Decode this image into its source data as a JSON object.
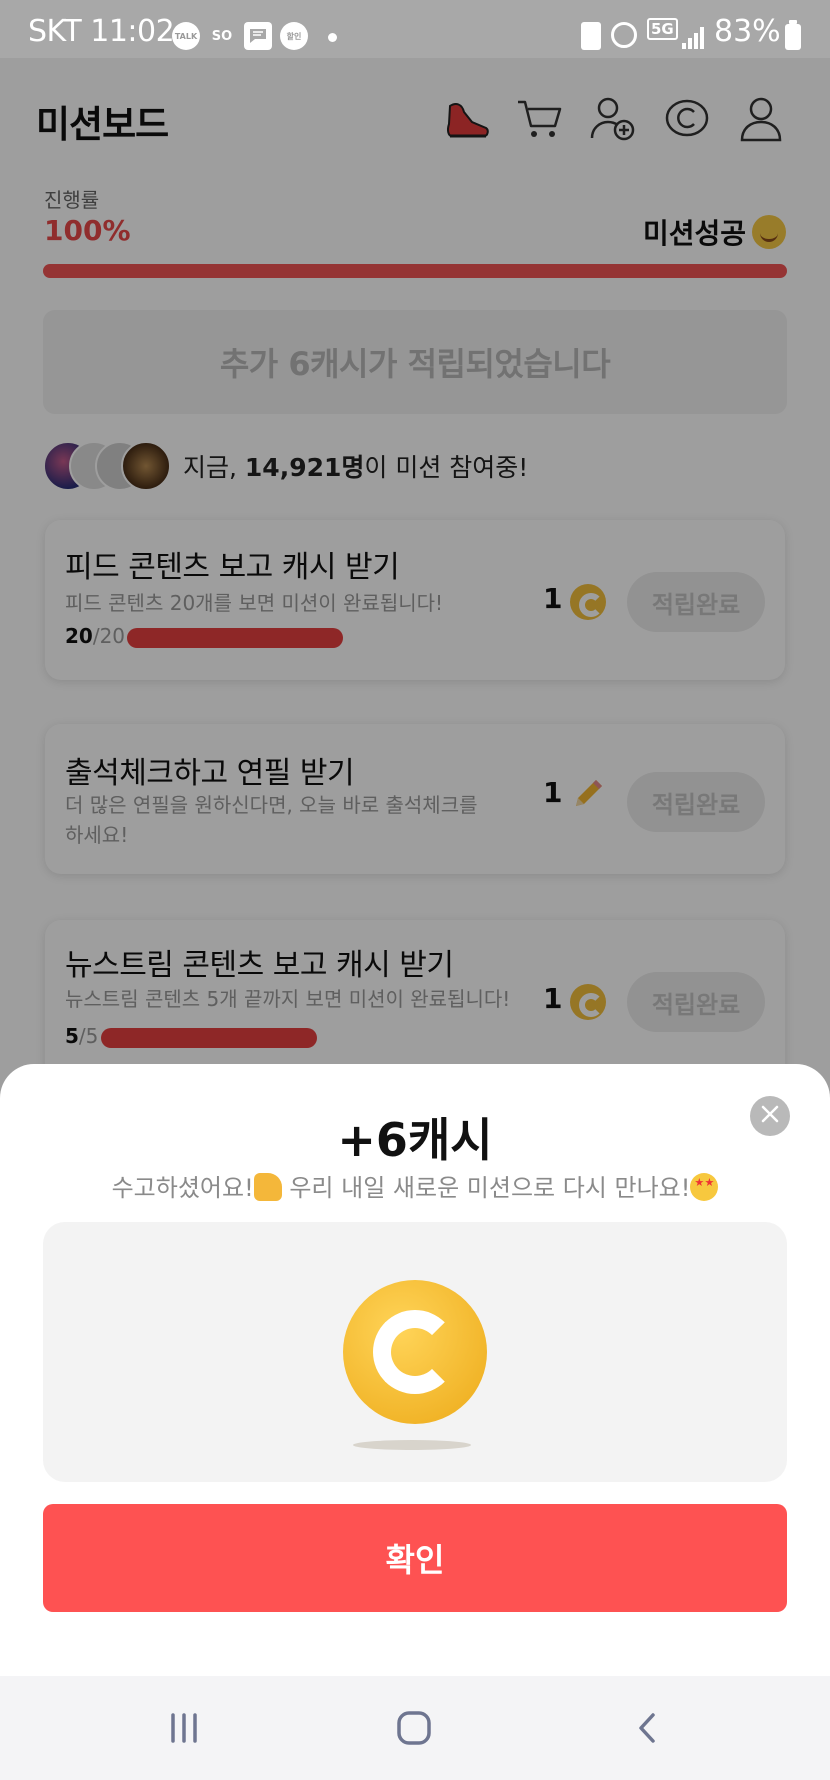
{
  "status_bar": {
    "carrier_time": "SKT 11:02",
    "notif_icons": [
      "TALK",
      "SO",
      "chat",
      "할인"
    ],
    "battery_text": "83%",
    "network": "5G"
  },
  "header": {
    "title": "미션보드",
    "icons": [
      "sneaker-icon",
      "cart-icon",
      "add-user-icon",
      "coin-icon",
      "profile-icon"
    ]
  },
  "progress": {
    "label": "진행률",
    "value": "100%",
    "fraction": 1.0,
    "status": "미션성공"
  },
  "banner": {
    "text": "추가 6캐시가 적립되었습니다"
  },
  "participants": {
    "prefix": "지금, ",
    "count": "14,921명",
    "suffix": "이 미션 참여중!"
  },
  "missions": [
    {
      "title": "피드 콘텐츠 보고 캐시 받기",
      "desc": "피드 콘텐츠 20개를 보면 미션이 완료됩니다!",
      "done": "20",
      "total": "/20",
      "progress": 1.0,
      "reward": "1",
      "reward_icon": "coin-icon",
      "button": "적립완료"
    },
    {
      "title": "출석체크하고 연필 받기",
      "desc": "더 많은 연필을 원하신다면, 오늘 바로 출석체크를 하세요!",
      "reward": "1",
      "reward_icon": "pencil-icon",
      "button": "적립완료"
    },
    {
      "title": "뉴스트림 콘텐츠 보고 캐시 받기",
      "desc": "뉴스트림 콘텐츠 5개 끝까지 보면 미션이 완료됩니다!",
      "done": "5",
      "total": "/5",
      "progress": 1.0,
      "reward": "1",
      "reward_icon": "coin-icon",
      "button": "적립완료"
    }
  ],
  "sheet": {
    "title": "+6캐시",
    "subtitle_a": "수고하셨어요!",
    "subtitle_b": " 우리 내일 새로운 미션으로 다시 만나요!",
    "confirm_label": "확인"
  },
  "colors": {
    "accent": "#fe5252",
    "progress": "#f05454",
    "coin": "#f2be3c"
  }
}
